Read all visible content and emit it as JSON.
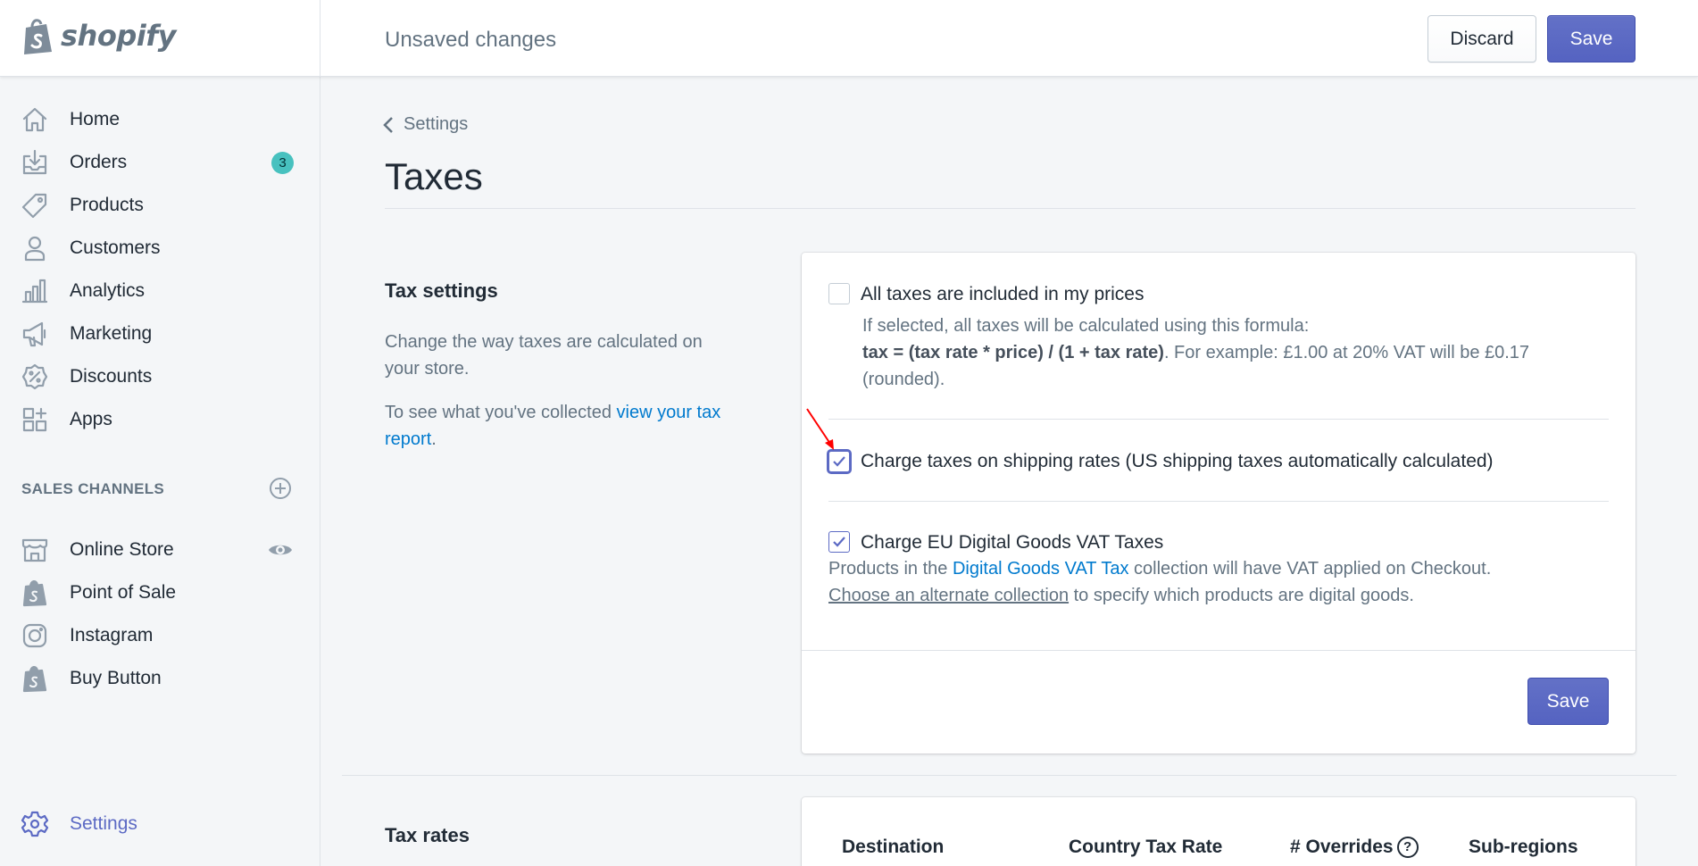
{
  "brand": {
    "name": "shopify",
    "colors": {
      "accent": "#5c6ac4",
      "link": "#007ace",
      "badge": "#47c1bf"
    }
  },
  "topbar": {
    "status": "Unsaved changes",
    "discard_label": "Discard",
    "save_label": "Save"
  },
  "sidebar": {
    "items": [
      {
        "label": "Home",
        "icon": "home-icon"
      },
      {
        "label": "Orders",
        "icon": "orders-icon",
        "badge": "3"
      },
      {
        "label": "Products",
        "icon": "tag-icon"
      },
      {
        "label": "Customers",
        "icon": "person-icon"
      },
      {
        "label": "Analytics",
        "icon": "bar-chart-icon"
      },
      {
        "label": "Marketing",
        "icon": "megaphone-icon"
      },
      {
        "label": "Discounts",
        "icon": "discount-icon"
      },
      {
        "label": "Apps",
        "icon": "apps-icon"
      }
    ],
    "sales_channels_heading": "SALES CHANNELS",
    "channels": [
      {
        "label": "Online Store",
        "icon": "store-icon"
      },
      {
        "label": "Point of Sale",
        "icon": "shopify-bag-icon"
      },
      {
        "label": "Instagram",
        "icon": "instagram-icon"
      },
      {
        "label": "Buy Button",
        "icon": "shopify-bag-icon"
      }
    ],
    "settings_label": "Settings"
  },
  "page": {
    "breadcrumb": "Settings",
    "title": "Taxes"
  },
  "tax_settings": {
    "title": "Tax settings",
    "description": "Change the way taxes are calculated on your store.",
    "report_prefix": "To see what you've collected ",
    "report_link": "view your tax report",
    "report_suffix": ".",
    "options": {
      "included": {
        "label": "All taxes are included in my prices",
        "checked": false,
        "help_line1": "If selected, all taxes will be calculated using this formula:",
        "formula": "tax = (tax rate * price) / (1 + tax rate)",
        "help_line2": ". For example: £1.00 at 20% VAT will be £0.17",
        "help_line3": "(rounded)."
      },
      "shipping": {
        "label": "Charge taxes on shipping rates (US shipping taxes automatically calculated)",
        "checked": true
      },
      "eu_vat": {
        "label": "Charge EU Digital Goods VAT Taxes",
        "checked": true,
        "help_prefix": "Products in the ",
        "help_link": "Digital Goods VAT Tax",
        "help_suffix": " collection will have VAT applied on Checkout.",
        "alt_link": "Choose an alternate collection",
        "alt_suffix": " to specify which products are digital goods."
      }
    },
    "save_label": "Save"
  },
  "tax_rates": {
    "title": "Tax rates",
    "columns": [
      "Destination",
      "Country Tax Rate",
      "# Overrides",
      "Sub-regions"
    ],
    "overrides_help": "?"
  }
}
